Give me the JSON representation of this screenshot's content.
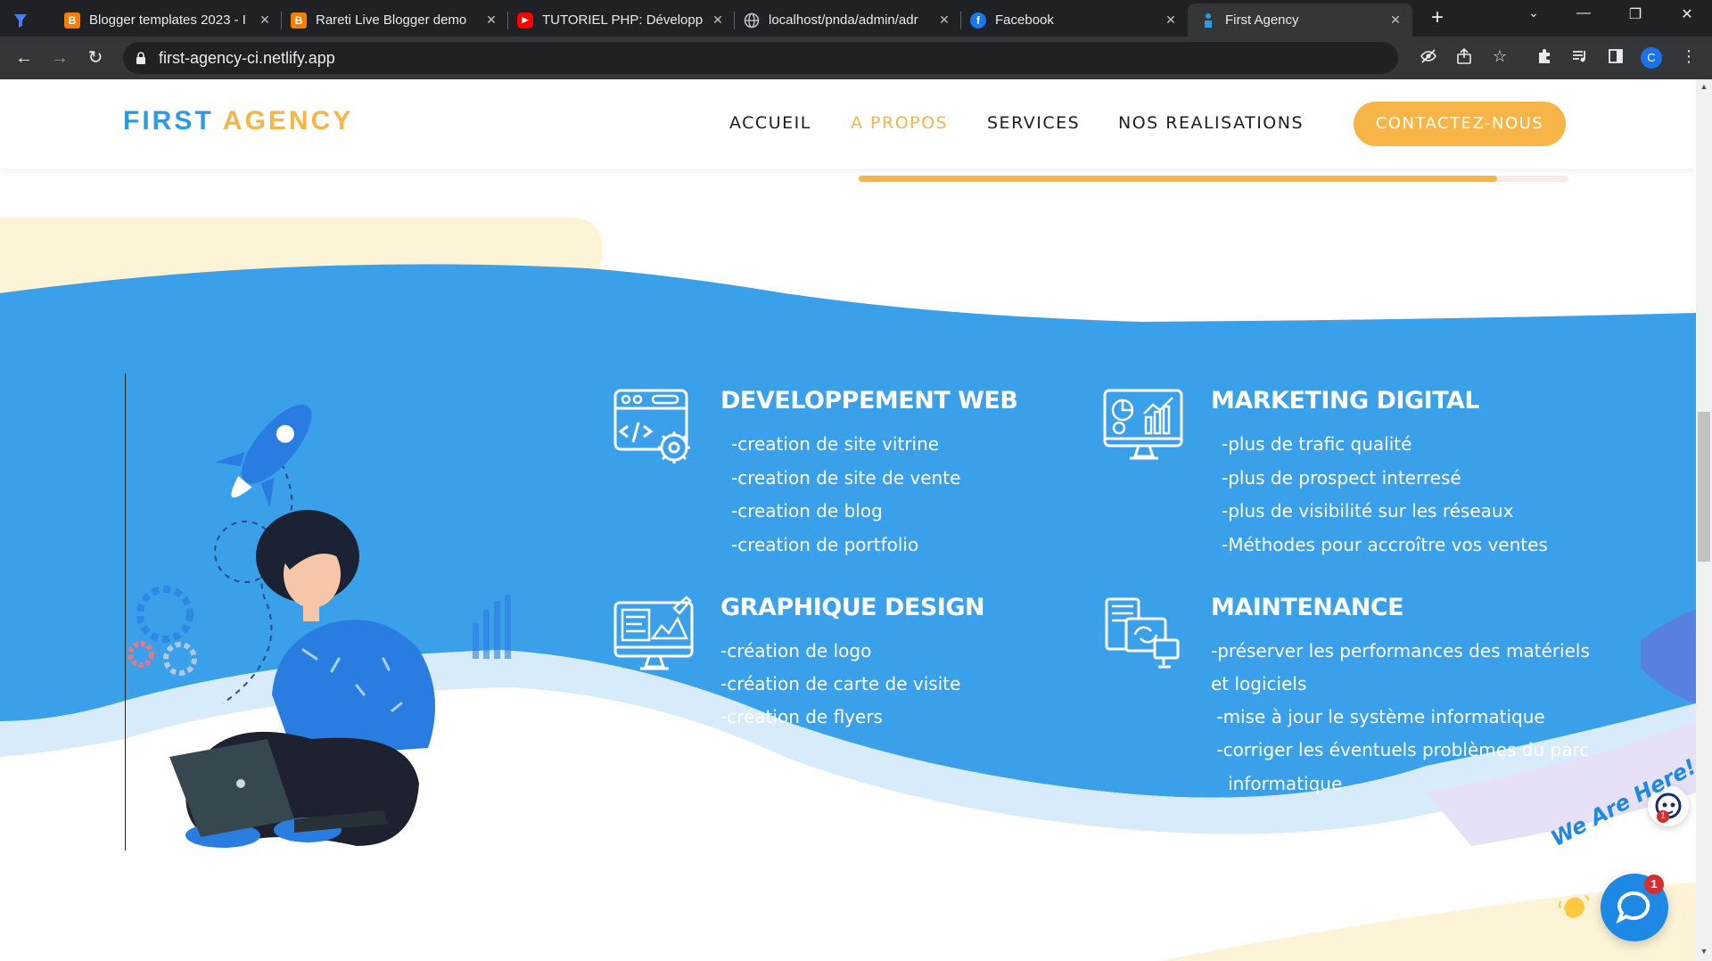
{
  "browser": {
    "tabs": [
      {
        "title": "",
        "icon": "filter-icon"
      },
      {
        "title": "Blogger templates 2023 - I",
        "icon": "blogger-icon"
      },
      {
        "title": "Rareti Live Blogger demo",
        "icon": "blogger-icon"
      },
      {
        "title": "TUTORIEL PHP: Développe",
        "icon": "youtube-icon"
      },
      {
        "title": "localhost/pnda/admin/adr",
        "icon": "globe-icon"
      },
      {
        "title": "Facebook",
        "icon": "facebook-icon"
      },
      {
        "title": "First Agency",
        "icon": "site-icon",
        "active": true
      }
    ],
    "url": "first-agency-ci.netlify.app",
    "profile_initial": "C"
  },
  "site": {
    "logo_part1": "FIRST",
    "logo_part2": "AGENCY",
    "nav": [
      "ACCUEIL",
      "A PROPOS",
      "SERVICES",
      "NOS REALISATIONS"
    ],
    "active_nav": "A PROPOS",
    "cta_label": "CONTACTEZ-NOUS",
    "progress_fraction": 0.9
  },
  "services": [
    {
      "title": "DEVELOPPEMENT WEB",
      "icon": "web-dev-icon",
      "items": [
        "-creation de site vitrine",
        "-creation de site de vente",
        "-creation de blog",
        "-creation de portfolio"
      ]
    },
    {
      "title": "MARKETING DIGITAL",
      "icon": "marketing-chart-icon",
      "items": [
        "-plus de trafic qualité",
        "-plus de prospect interresé",
        "-plus de visibilité sur les réseaux",
        "-Méthodes pour accroître vos ventes"
      ]
    },
    {
      "title": "GRAPHIQUE DESIGN",
      "icon": "graphic-design-icon",
      "items": [
        "-création de logo",
        "-création de carte de visite",
        " -création de flyers"
      ]
    },
    {
      "title": "MAINTENANCE",
      "icon": "maintenance-icon",
      "items": [
        "-préserver les performances des matériels",
        "et logiciels",
        " -mise à jour le système informatique",
        " -corriger les éventuels problèmes du parc",
        "   informatique"
      ]
    }
  ],
  "chat": {
    "tagline": "We Are Here!",
    "badge_count": "1",
    "mini_badge_count": "1"
  },
  "colors": {
    "primary_blue": "#2b9be6",
    "accent_orange": "#f7b547",
    "section_blue": "#3aa0ea",
    "purple_blob": "#7b6ad8",
    "cream_blob": "#fdf4d8"
  }
}
